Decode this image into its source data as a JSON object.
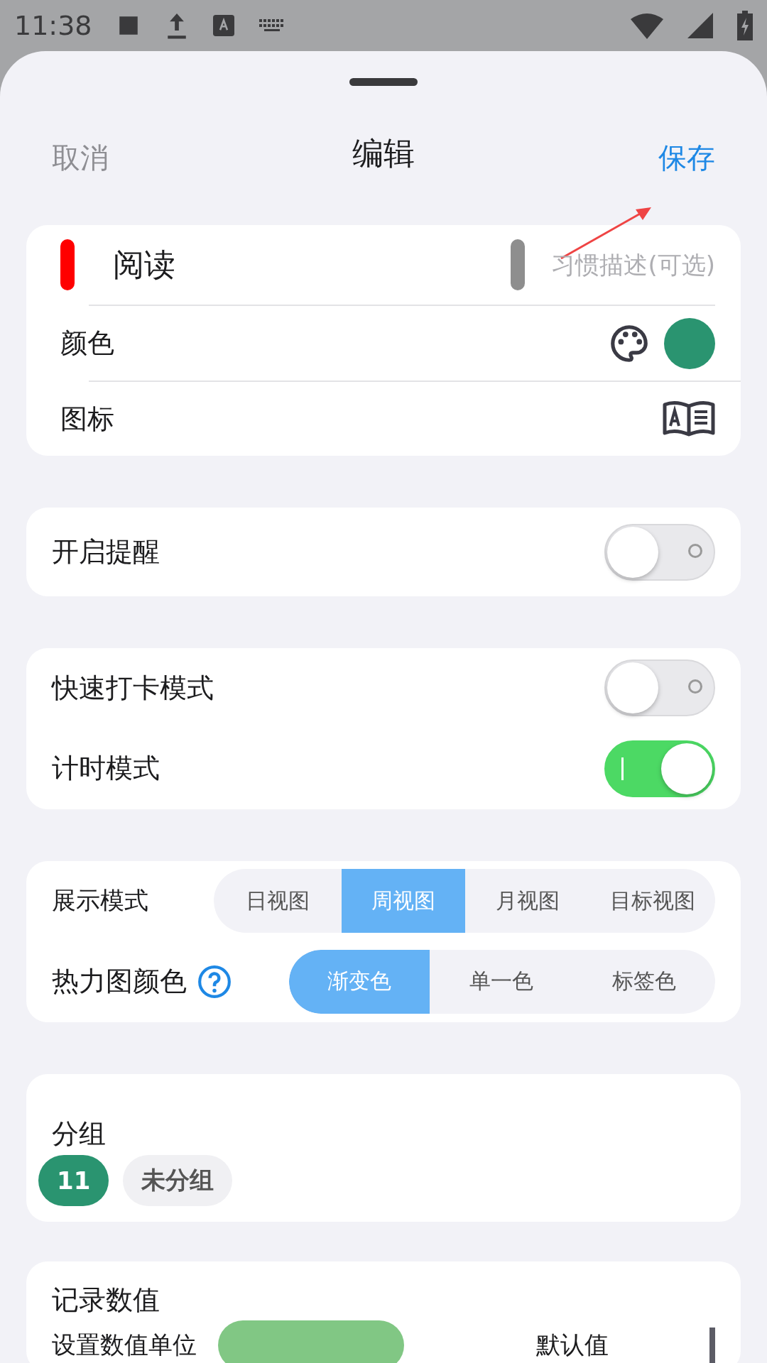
{
  "status_bar": {
    "time": "11:38"
  },
  "header": {
    "cancel": "取消",
    "title": "编辑",
    "save": "保存"
  },
  "habit": {
    "name": "阅读",
    "description_placeholder": "习惯描述(可选)",
    "color_label": "颜色",
    "color": "#2a9470",
    "icon_label": "图标"
  },
  "reminder": {
    "label": "开启提醒",
    "on": false
  },
  "modes": [
    {
      "label": "快速打卡模式",
      "on": false
    },
    {
      "label": "计时模式",
      "on": true
    }
  ],
  "display_mode": {
    "label": "展示模式",
    "options": [
      {
        "label": "日视图",
        "selected": false
      },
      {
        "label": "周视图",
        "selected": true
      },
      {
        "label": "月视图",
        "selected": false
      },
      {
        "label": "目标视图",
        "selected": false
      }
    ]
  },
  "heatmap_color": {
    "label": "热力图颜色",
    "options": [
      {
        "label": "渐变色",
        "selected": true
      },
      {
        "label": "单一色",
        "selected": false
      },
      {
        "label": "标签色",
        "selected": false
      }
    ]
  },
  "group": {
    "title": "分组",
    "chips": [
      {
        "label": "11",
        "selected": true
      },
      {
        "label": "未分组",
        "selected": false
      }
    ]
  },
  "record": {
    "title": "记录数值",
    "unit_label": "设置数值单位",
    "default_label": "默认值"
  }
}
